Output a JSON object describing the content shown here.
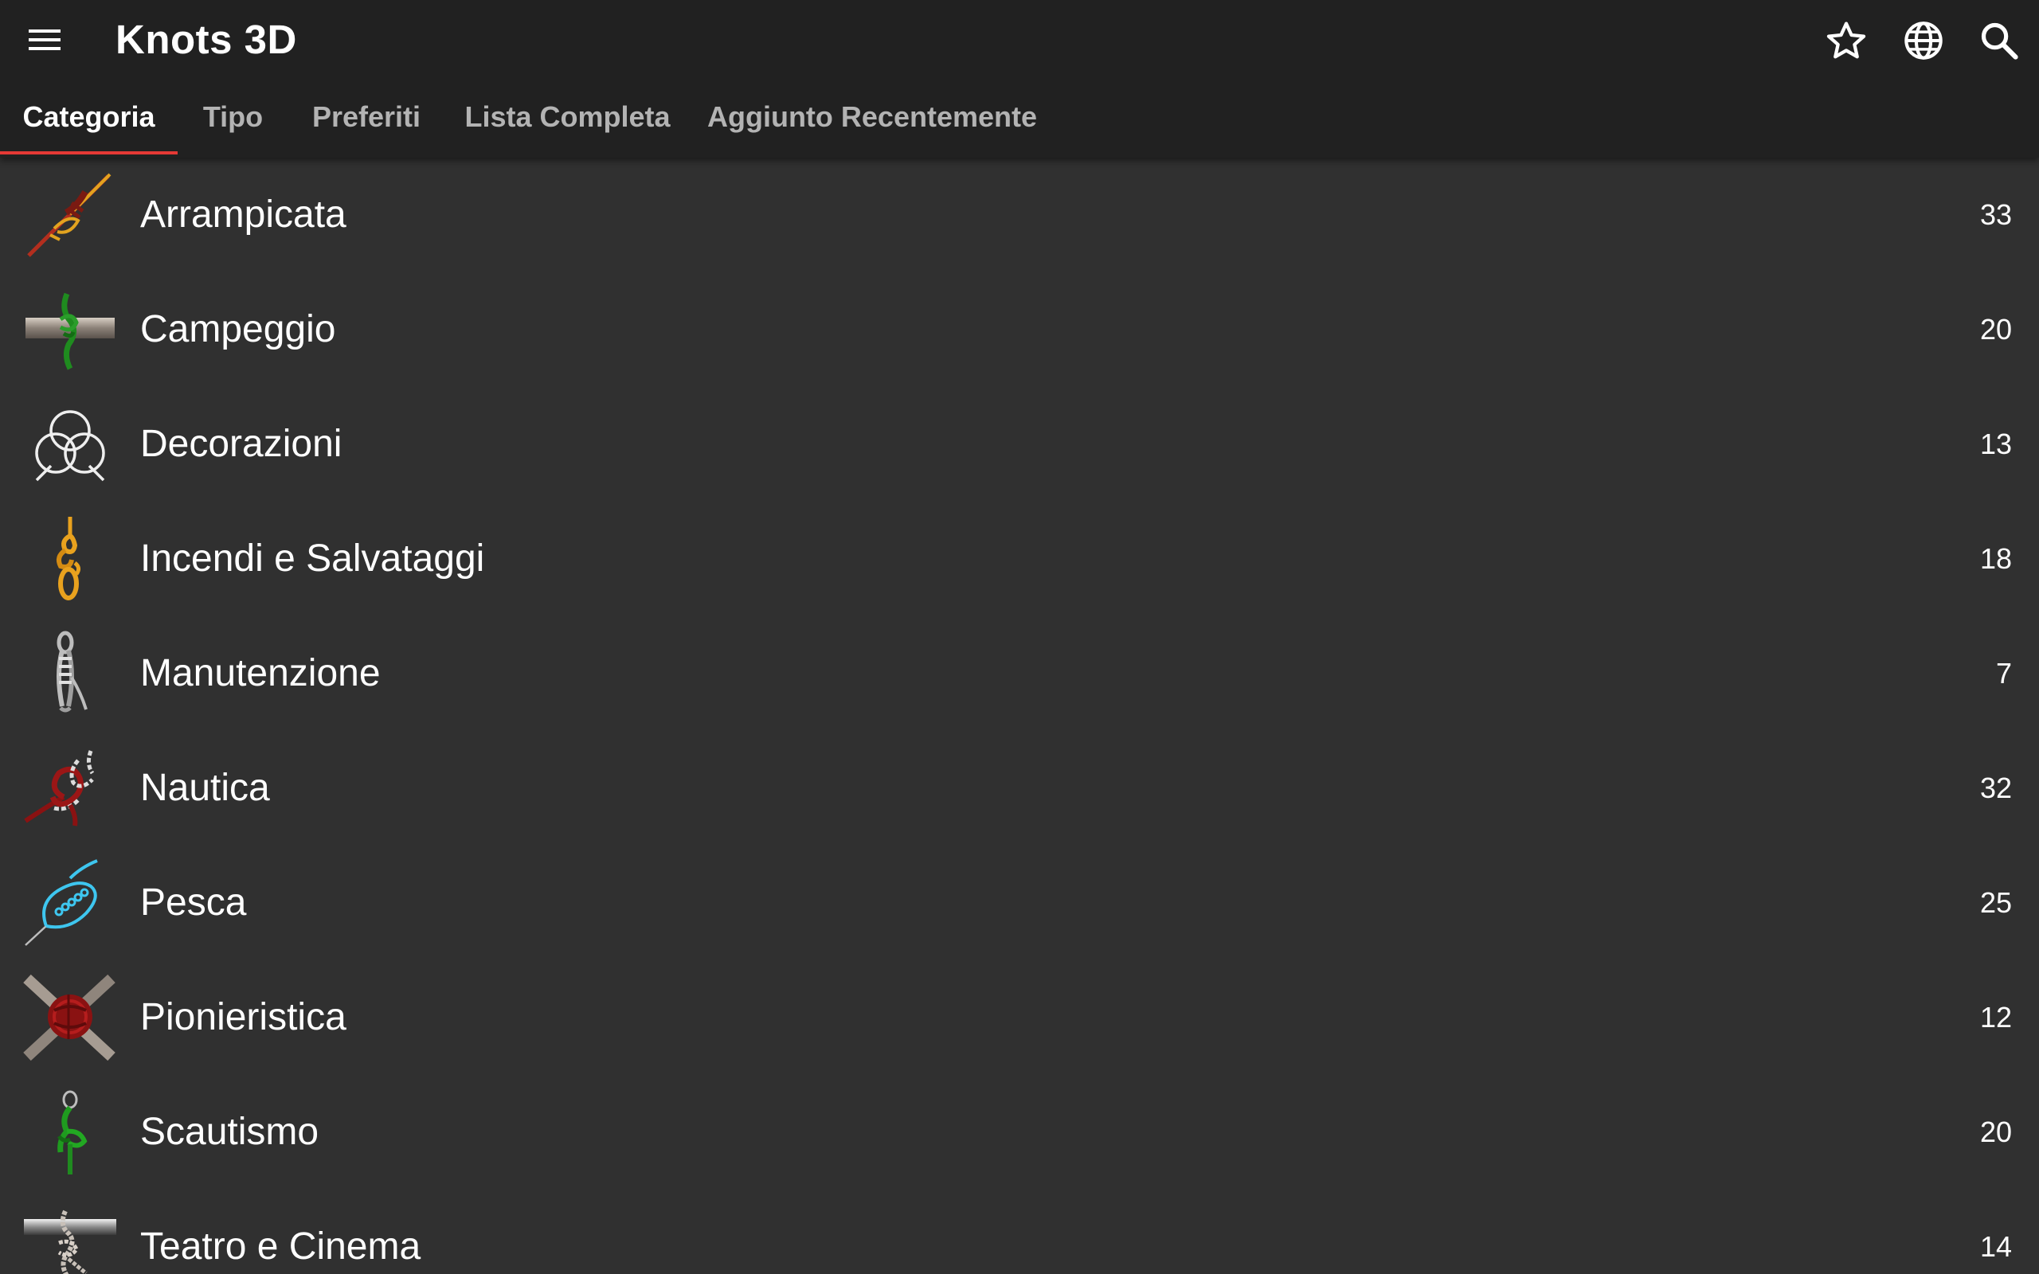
{
  "app": {
    "title": "Knots 3D"
  },
  "toolbar": {
    "menu_icon": "hamburger-menu-icon",
    "actions": [
      {
        "name": "favorites",
        "icon": "star-outline-icon"
      },
      {
        "name": "language",
        "icon": "globe-icon"
      },
      {
        "name": "search",
        "icon": "search-icon"
      }
    ]
  },
  "tabs": [
    {
      "label": "Categoria",
      "active": true
    },
    {
      "label": "Tipo",
      "active": false
    },
    {
      "label": "Preferiti",
      "active": false
    },
    {
      "label": "Lista Completa",
      "active": false
    },
    {
      "label": "Aggiunto Recentemente",
      "active": false
    }
  ],
  "colors": {
    "appbar": "#212121",
    "background": "#303030",
    "tab_indicator": "#e53935",
    "tab_inactive": "#b3b3b3",
    "text": "#ffffff"
  },
  "categories": [
    {
      "label": "Arrampicata",
      "count": "33",
      "icon": "climbing-knot-icon"
    },
    {
      "label": "Campeggio",
      "count": "20",
      "icon": "camping-knot-icon"
    },
    {
      "label": "Decorazioni",
      "count": "13",
      "icon": "decorative-knot-icon"
    },
    {
      "label": "Incendi e Salvataggi",
      "count": "18",
      "icon": "rescue-knot-icon"
    },
    {
      "label": "Manutenzione",
      "count": "7",
      "icon": "maintenance-knot-icon"
    },
    {
      "label": "Nautica",
      "count": "32",
      "icon": "nautical-knot-icon"
    },
    {
      "label": "Pesca",
      "count": "25",
      "icon": "fishing-knot-icon"
    },
    {
      "label": "Pionieristica",
      "count": "12",
      "icon": "pioneering-knot-icon"
    },
    {
      "label": "Scautismo",
      "count": "20",
      "icon": "scouting-knot-icon"
    },
    {
      "label": "Teatro e Cinema",
      "count": "14",
      "icon": "theater-knot-icon"
    }
  ]
}
